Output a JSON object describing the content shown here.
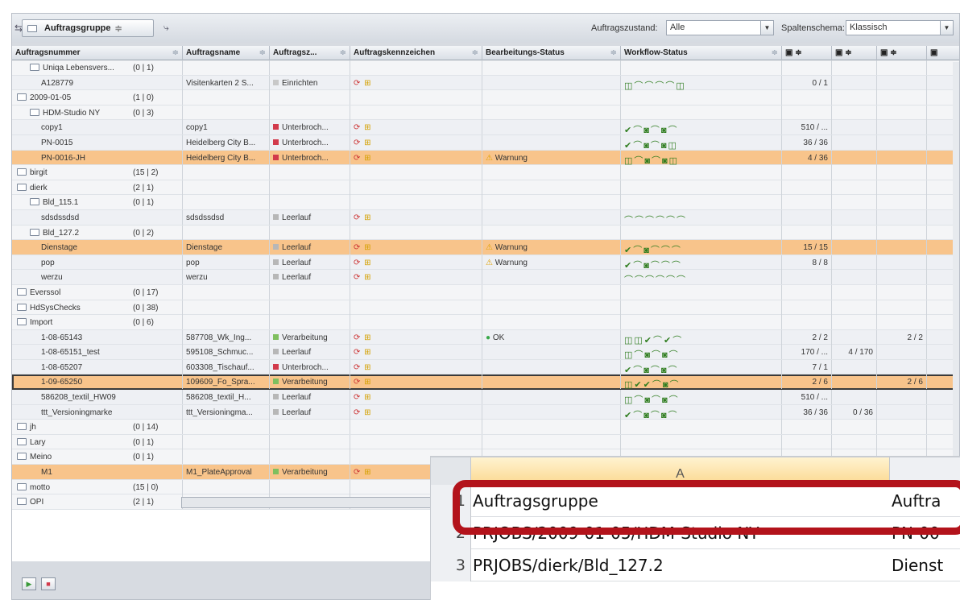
{
  "toolbar": {
    "group_label": "Auftragsgruppe",
    "state_label": "Auftragszustand:",
    "state_value": "Alle",
    "schema_label": "Spaltenschema:",
    "schema_value": "Klassisch"
  },
  "columns": [
    "Auftragsnummer",
    "Auftragsname",
    "Auftragsz...",
    "Auftragskennzeichen",
    "Bearbeitungs-Status",
    "Workflow-Status"
  ],
  "rows": [
    {
      "kind": "sub",
      "n": "Uniqa Lebensvers...",
      "c": "(0 | 1)",
      "name": "",
      "state": "",
      "status": "",
      "wf": "",
      "qty": "",
      "q2": "",
      "q3": ""
    },
    {
      "kind": "item",
      "n": "A128779",
      "c": "",
      "name": "Visitenkarten 2 S...",
      "state": "Einrichten",
      "sc": "#c8c8c8",
      "status": "",
      "wf": "◫⌒⌒⌒⌒◫",
      "qty": "0 / 1",
      "q2": "",
      "q3": ""
    },
    {
      "kind": "grp",
      "n": "2009-01-05",
      "c": "(1 | 0)",
      "name": "",
      "state": "",
      "status": "",
      "wf": "",
      "qty": "",
      "q2": "",
      "q3": ""
    },
    {
      "kind": "sub",
      "n": "HDM-Studio NY",
      "c": "(0 | 3)",
      "name": "",
      "state": "",
      "status": "",
      "wf": "",
      "qty": "",
      "q2": "",
      "q3": ""
    },
    {
      "kind": "item",
      "n": "copy1",
      "c": "",
      "name": "copy1",
      "state": "Unterbroch...",
      "sc": "#d23a4b",
      "status": "",
      "wf": "✔⌒◙⌒◙⌒",
      "qty": "510 / ...",
      "q2": "",
      "q3": ""
    },
    {
      "kind": "item",
      "n": "PN-0015",
      "c": "",
      "name": "Heidelberg City B...",
      "state": "Unterbroch...",
      "sc": "#d23a4b",
      "status": "",
      "wf": "✔⌒◙⌒◙◫",
      "qty": "36 / 36",
      "q2": "",
      "q3": ""
    },
    {
      "kind": "hl",
      "n": "PN-0016-JH",
      "c": "",
      "name": "Heidelberg City B...",
      "state": "Unterbroch...",
      "sc": "#d23a4b",
      "status": "Warnung",
      "wf": "◫⌒◙⌒◙◫",
      "qty": "4 / 36",
      "q2": "",
      "q3": ""
    },
    {
      "kind": "grp",
      "n": "birgit",
      "c": "(15 | 2)",
      "name": "",
      "state": "",
      "status": "",
      "wf": "",
      "qty": "",
      "q2": "",
      "q3": ""
    },
    {
      "kind": "grp",
      "n": "dierk",
      "c": "(2 | 1)",
      "name": "",
      "state": "",
      "status": "",
      "wf": "",
      "qty": "",
      "q2": "",
      "q3": ""
    },
    {
      "kind": "sub",
      "n": "Bld_115.1",
      "c": "(0 | 1)",
      "name": "",
      "state": "",
      "status": "",
      "wf": "",
      "qty": "",
      "q2": "",
      "q3": ""
    },
    {
      "kind": "item",
      "n": "sdsdssdsd",
      "c": "",
      "name": "sdsdssdsd",
      "state": "Leerlauf",
      "sc": "#b7b7b7",
      "status": "",
      "wf": "⌒⌒⌒⌒⌒⌒",
      "qty": "",
      "q2": "",
      "q3": ""
    },
    {
      "kind": "sub",
      "n": "Bld_127.2",
      "c": "(0 | 2)",
      "name": "",
      "state": "",
      "status": "",
      "wf": "",
      "qty": "",
      "q2": "",
      "q3": ""
    },
    {
      "kind": "hl",
      "n": "Dienstage",
      "c": "",
      "name": "Dienstage",
      "state": "Leerlauf",
      "sc": "#b7b7b7",
      "status": "Warnung",
      "wf": "✔⌒◙⌒⌒⌒",
      "qty": "15 / 15",
      "q2": "",
      "q3": ""
    },
    {
      "kind": "item",
      "n": "pop",
      "c": "",
      "name": "pop",
      "state": "Leerlauf",
      "sc": "#b7b7b7",
      "status": "Warnung",
      "wf": "✔⌒◙⌒⌒⌒",
      "qty": "8 / 8",
      "q2": "",
      "q3": ""
    },
    {
      "kind": "item",
      "n": "werzu",
      "c": "",
      "name": "werzu",
      "state": "Leerlauf",
      "sc": "#b7b7b7",
      "status": "",
      "wf": "⌒⌒⌒⌒⌒⌒",
      "qty": "",
      "q2": "",
      "q3": ""
    },
    {
      "kind": "grp",
      "n": "Everssol",
      "c": "(0 | 17)",
      "name": "",
      "state": "",
      "status": "",
      "wf": "",
      "qty": "",
      "q2": "",
      "q3": ""
    },
    {
      "kind": "grp",
      "n": "HdSysChecks",
      "c": "(0 | 38)",
      "name": "",
      "state": "",
      "status": "",
      "wf": "",
      "qty": "",
      "q2": "",
      "q3": ""
    },
    {
      "kind": "grp",
      "n": "Import",
      "c": "(0 | 6)",
      "name": "",
      "state": "",
      "status": "",
      "wf": "",
      "qty": "",
      "q2": "",
      "q3": ""
    },
    {
      "kind": "item",
      "n": "1-08-65143",
      "c": "",
      "name": "587708_Wk_Ing...",
      "state": "Verarbeitung",
      "sc": "#7fbf5f",
      "status": "OK",
      "wf": "◫◫✔⌒✔⌒",
      "qty": "2 / 2",
      "q2": "",
      "q3": "2 / 2"
    },
    {
      "kind": "item",
      "n": "1-08-65151_test",
      "c": "",
      "name": "595108_Schmuc...",
      "state": "Leerlauf",
      "sc": "#b7b7b7",
      "status": "",
      "wf": "◫⌒◙⌒◙⌒",
      "qty": "170 / ...",
      "q2": "4 / 170",
      "q3": ""
    },
    {
      "kind": "item",
      "n": "1-08-65207",
      "c": "",
      "name": "603308_Tischauf...",
      "state": "Unterbroch...",
      "sc": "#d23a4b",
      "status": "",
      "wf": "✔⌒◙⌒◙⌒",
      "qty": "7 / 1",
      "q2": "",
      "q3": ""
    },
    {
      "kind": "sel",
      "n": "1-09-65250",
      "c": "",
      "name": "109609_Fo_Spra...",
      "state": "Verarbeitung",
      "sc": "#7fbf5f",
      "status": "",
      "wf": "◫✔✔⌒◙⌒",
      "qty": "2 / 6",
      "q2": "",
      "q3": "2 / 6"
    },
    {
      "kind": "item",
      "n": "586208_textil_HW09",
      "c": "",
      "name": "586208_textil_H...",
      "state": "Leerlauf",
      "sc": "#b7b7b7",
      "status": "",
      "wf": "◫⌒◙⌒◙⌒",
      "qty": "510 / ...",
      "q2": "",
      "q3": ""
    },
    {
      "kind": "item",
      "n": "ttt_Versioningmarke",
      "c": "",
      "name": "ttt_Versioningma...",
      "state": "Leerlauf",
      "sc": "#b7b7b7",
      "status": "",
      "wf": "✔⌒◙⌒◙⌒",
      "qty": "36 / 36",
      "q2": "0 / 36",
      "q3": ""
    },
    {
      "kind": "grp",
      "n": "jh",
      "c": "(0 | 14)",
      "name": "",
      "state": "",
      "status": "",
      "wf": "",
      "qty": "",
      "q2": "",
      "q3": ""
    },
    {
      "kind": "grp",
      "n": "Lary",
      "c": "(0 | 1)",
      "name": "",
      "state": "",
      "status": "",
      "wf": "",
      "qty": "",
      "q2": "",
      "q3": ""
    },
    {
      "kind": "grp",
      "n": "Meino",
      "c": "(0 | 1)",
      "name": "",
      "state": "",
      "status": "",
      "wf": "",
      "qty": "",
      "q2": "",
      "q3": ""
    },
    {
      "kind": "hl",
      "n": "M1",
      "c": "",
      "name": "M1_PlateApproval",
      "state": "Verarbeitung",
      "sc": "#7fbf5f",
      "status": "",
      "wf": "",
      "qty": "",
      "q2": "",
      "q3": ""
    },
    {
      "kind": "grp",
      "n": "motto",
      "c": "(15 | 0)",
      "name": "",
      "state": "",
      "status": "",
      "wf": "",
      "qty": "",
      "q2": "",
      "q3": ""
    },
    {
      "kind": "grp",
      "n": "OPI",
      "c": "(2 | 1)",
      "name": "",
      "state": "",
      "status": "",
      "wf": "",
      "qty": "",
      "q2": "",
      "q3": ""
    }
  ],
  "excel": {
    "col_a": "A",
    "rows": [
      {
        "num": "1",
        "a": "Auftragsgruppe",
        "b": "Auftra"
      },
      {
        "num": "2",
        "a": "PRJOBS/2009-01-05/HDM-Studio NY",
        "b": "PN-00"
      },
      {
        "num": "3",
        "a": "PRJOBS/dierk/Bld_127.2",
        "b": "Dienst"
      }
    ]
  }
}
